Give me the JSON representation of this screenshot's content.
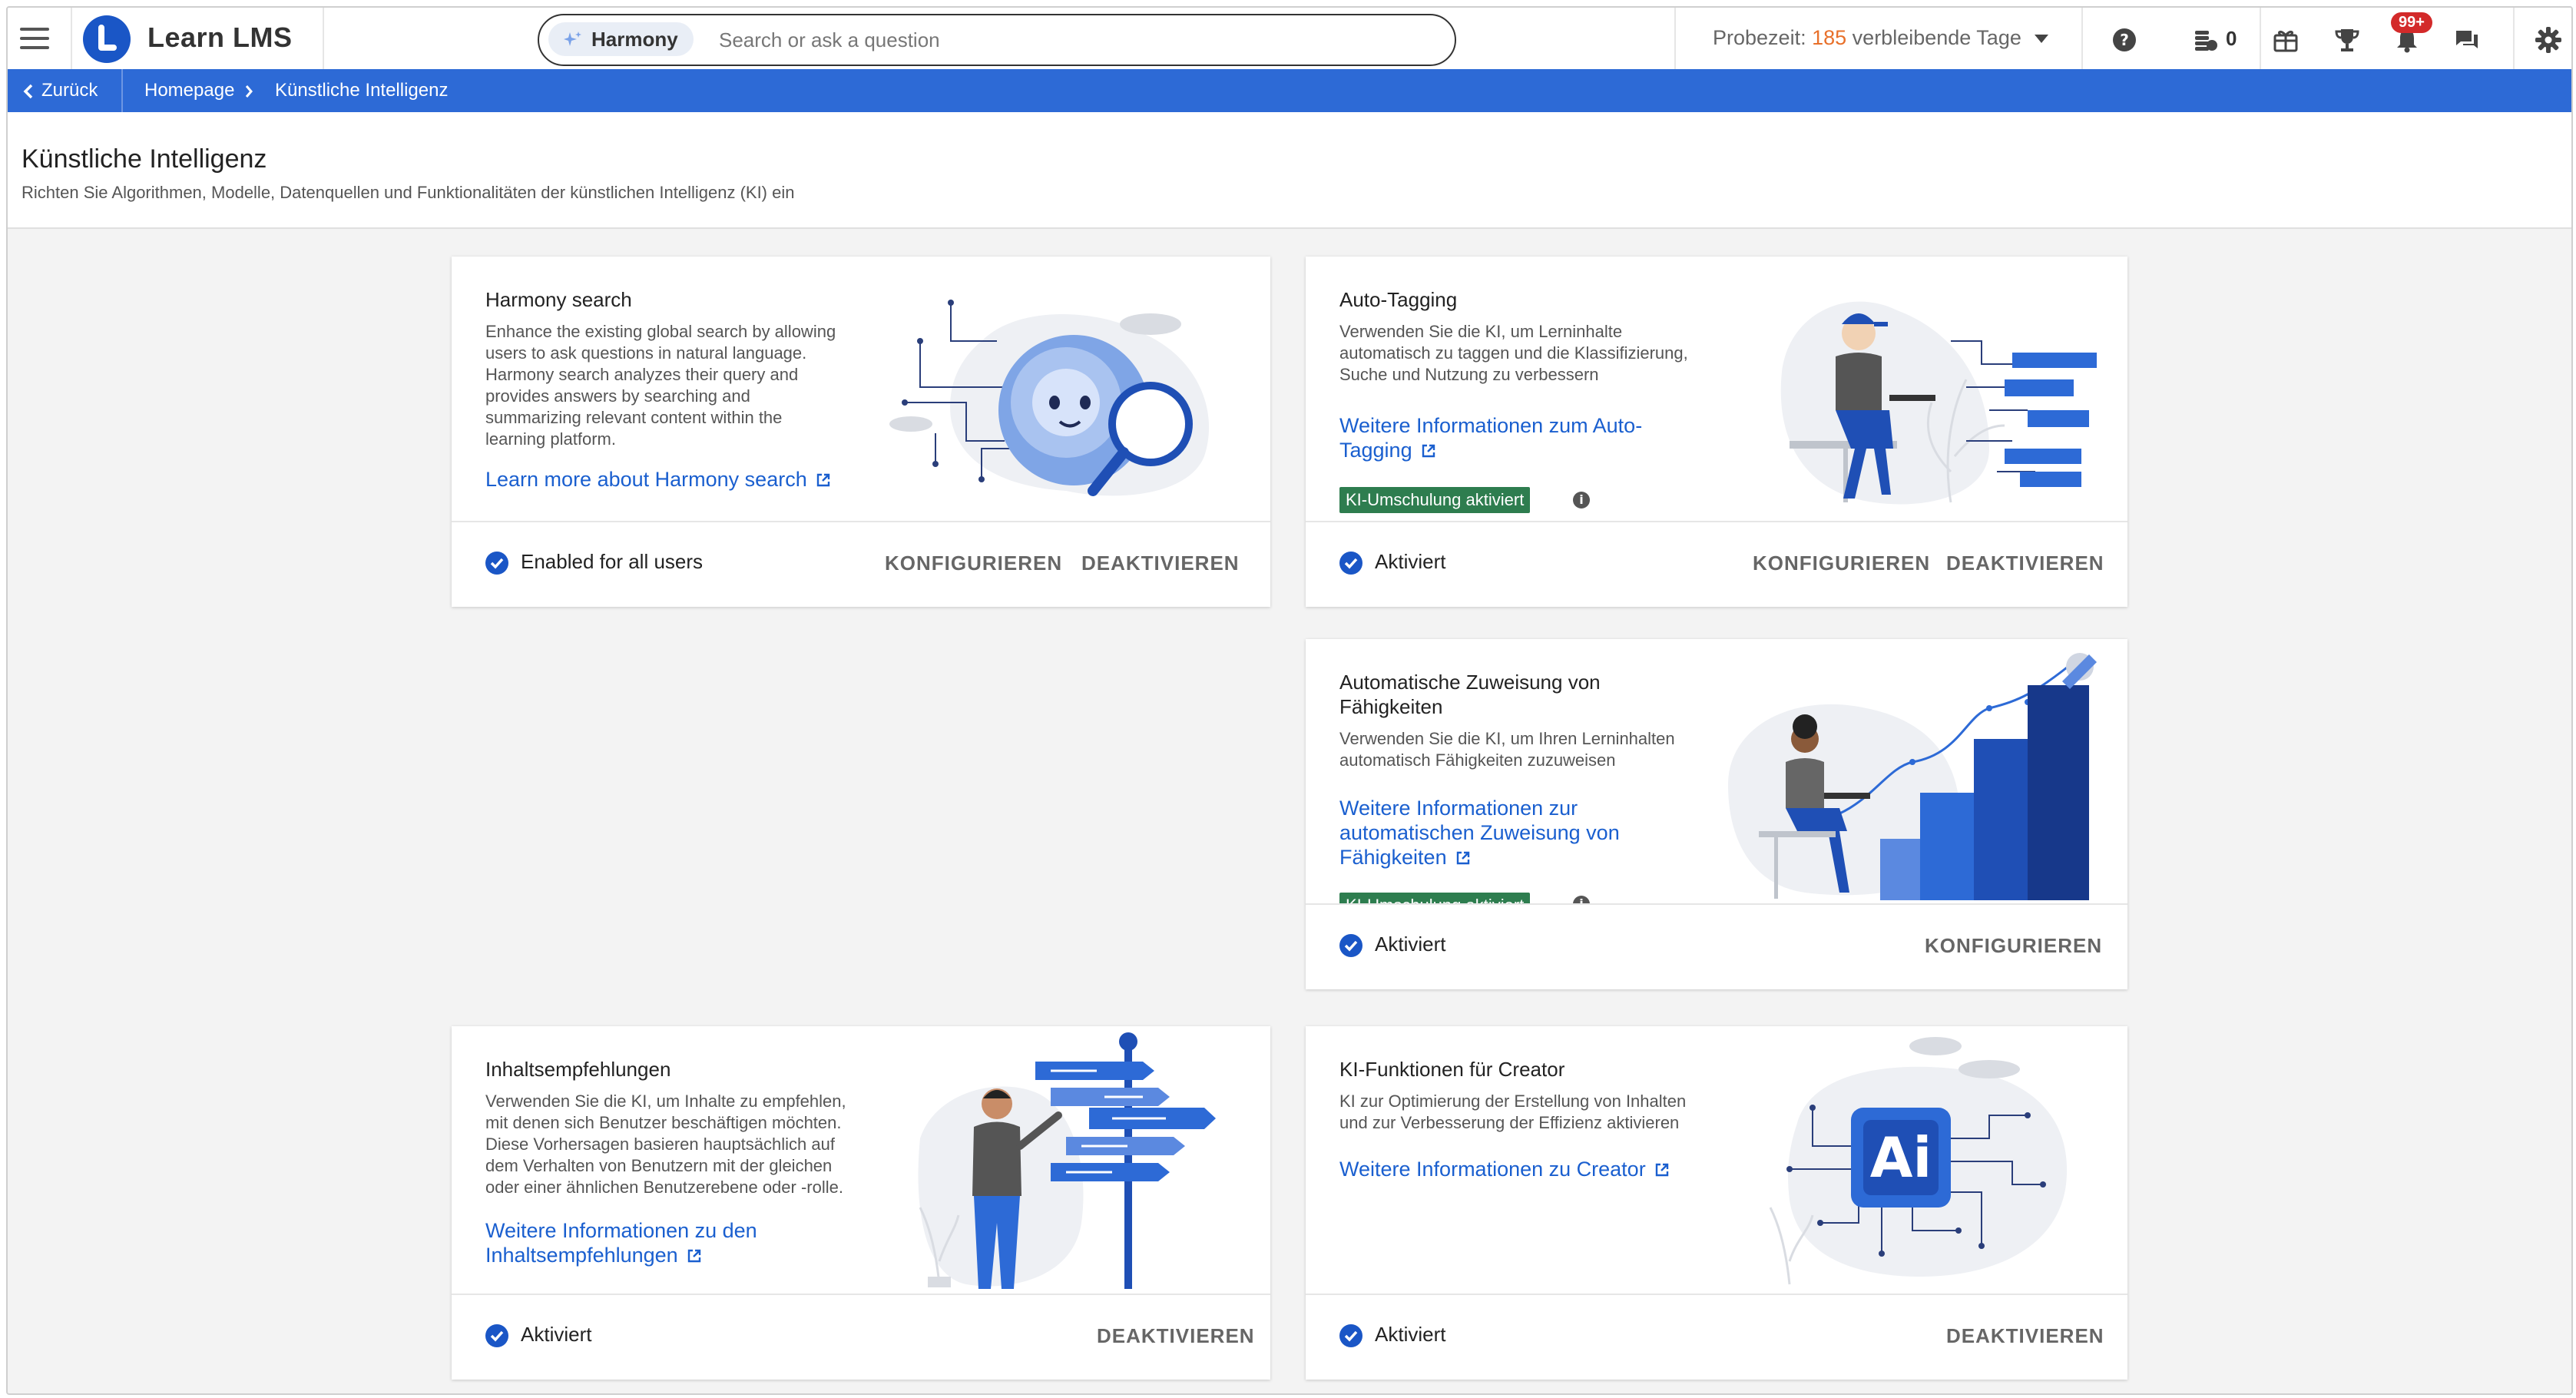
{
  "app": {
    "name": "Learn LMS"
  },
  "search": {
    "harmony_label": "Harmony",
    "placeholder": "Search or ask a question"
  },
  "header": {
    "trial_label": "Probezeit:",
    "trial_days": "185",
    "trial_suffix": "verbleibende Tage",
    "credits": "0",
    "notification_badge": "99+"
  },
  "breadcrumb": {
    "back": "Zurück",
    "items": [
      "Homepage",
      "Künstliche Intelligenz"
    ]
  },
  "page": {
    "title": "Künstliche Intelligenz",
    "subtitle": "Richten Sie Algorithmen, Modelle, Datenquellen und Funktionalitäten der künstlichen Intelligenz (KI) ein"
  },
  "cards": [
    {
      "title": "Harmony search",
      "description": "Enhance the existing global search by allowing users to ask questions in natural language. Harmony search analyzes their query and provides answers by searching and summarizing relevant content within the learning platform.",
      "link": "Learn more about Harmony search",
      "status": "Enabled for all users",
      "actions": [
        "KONFIGURIEREN",
        "DEAKTIVIEREN"
      ]
    },
    {
      "title": "Auto-Tagging",
      "description": "Verwenden Sie die KI, um Lerninhalte automatisch zu taggen und die Klassifizierung, Suche und Nutzung zu verbessern",
      "link_line1": "Weitere Informationen zum Auto-",
      "link_line2": "Tagging",
      "tag": "KI-Umschulung aktiviert",
      "status": "Aktiviert",
      "actions": [
        "KONFIGURIEREN",
        "DEAKTIVIEREN"
      ]
    },
    {
      "title_line1": "Automatische Zuweisung von",
      "title_line2": "Fähigkeiten",
      "description": "Verwenden Sie die KI, um Ihren Lerninhalten automatisch Fähigkeiten zuzuweisen",
      "link_line1": "Weitere Informationen zur",
      "link_line2": "automatischen Zuweisung von",
      "link_line3": "Fähigkeiten",
      "tag": "KI-Umschulung aktiviert",
      "status": "Aktiviert",
      "actions": [
        "KONFIGURIEREN"
      ]
    },
    {
      "title": "Inhaltsempfehlungen",
      "description": "Verwenden Sie die KI, um Inhalte zu empfehlen, mit denen sich Benutzer beschäftigen möchten. Diese Vorhersagen basieren hauptsächlich auf dem Verhalten von Benutzern mit der gleichen oder einer ähnlichen Benutzerebene oder -rolle.",
      "link_line1": "Weitere Informationen zu den",
      "link_line2": "Inhaltsempfehlungen",
      "status": "Aktiviert",
      "actions": [
        "DEAKTIVIEREN"
      ]
    },
    {
      "title": "KI-Funktionen für Creator",
      "description": "KI zur Optimierung der Erstellung von Inhalten und zur Verbesserung der Effizienz aktivieren",
      "link": "Weitere Informationen zu Creator",
      "status": "Aktiviert",
      "actions": [
        "DEAKTIVIEREN"
      ]
    }
  ],
  "colors": {
    "brand": "#1a56c6",
    "bar": "#2d6ad6",
    "link": "#1a5fcf",
    "tag": "#2e7d4f",
    "badge": "#d32a2a",
    "trial_days": "#e8702a"
  }
}
